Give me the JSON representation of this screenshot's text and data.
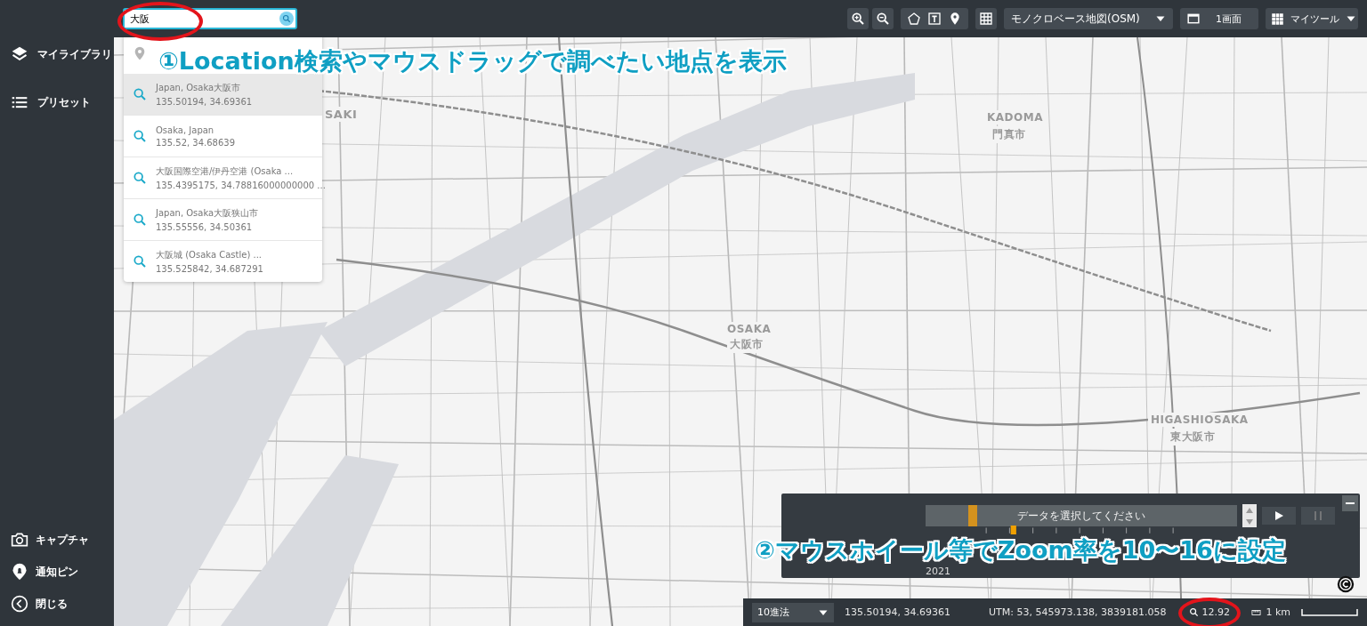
{
  "sidebar": {
    "top_items": [
      {
        "label": "マイライブラリ",
        "kind": "layers"
      },
      {
        "label": "プリセット",
        "kind": "list"
      }
    ],
    "bottom_items": [
      {
        "label": "キャプチャ",
        "kind": "camera"
      },
      {
        "label": "通知ピン",
        "kind": "pin"
      },
      {
        "label": "閉じる",
        "kind": "close"
      }
    ]
  },
  "search": {
    "value": "大阪"
  },
  "toolbar": {
    "basemap": "モノクロベース地図(OSM)",
    "layout": "1画面",
    "tools": "マイツール"
  },
  "search_results": [
    {
      "name": "Japan, Osaka大阪市",
      "coords": "135.50194, 34.69361",
      "selected": true
    },
    {
      "name": "Osaka, Japan",
      "coords": "135.52, 34.68639",
      "selected": false
    },
    {
      "name": "大阪国際空港/伊丹空港 (Osaka ...",
      "coords": "135.4395175, 34.78816000000000 ...",
      "selected": false
    },
    {
      "name": "Japan, Osaka大阪狭山市",
      "coords": "135.55556, 34.50361",
      "selected": false
    },
    {
      "name": "大阪城 (Osaka Castle) ...",
      "coords": "135.525842, 34.687291",
      "selected": false
    }
  ],
  "map": {
    "labels": [
      "SAKI",
      "KADOMA",
      "門真市",
      "OSAKA",
      "大阪市",
      "HIGASHIOSAKA",
      "東大阪市"
    ]
  },
  "timeline": {
    "data_placeholder": "データを選択してください",
    "year": "2021"
  },
  "status_bar": {
    "format": "10進法",
    "lonlat": "135.50194, 34.69361",
    "utm": "UTM: 53, 545973.138, 3839181.058",
    "zoom": "12.92",
    "scale": "1 km"
  },
  "annotations": [
    {
      "text": "①Location検索やマウスドラッグで調べたい地点を表示"
    },
    {
      "text": "②マウスホイール等でZoom率を10〜16に設定"
    }
  ]
}
